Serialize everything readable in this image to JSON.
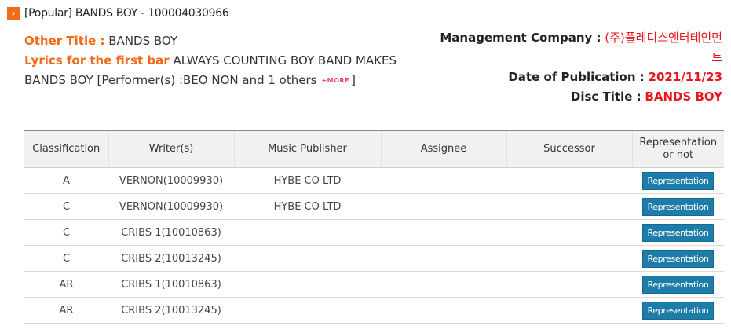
{
  "header": {
    "arrow_glyph": "›",
    "title": "[Popular] BANDS BOY - 100004030966"
  },
  "info": {
    "other_title_label": "Other Title :",
    "other_title_value": "BANDS BOY",
    "lyrics_label": "Lyrics for the first bar",
    "lyrics_value_1": "ALWAYS COUNTING BOY BAND MAKES",
    "lyrics_value_2": "BANDS BOY [Performer(s) :BEO NON and 1 others",
    "more_label": "+MORE",
    "close_bracket": "]"
  },
  "meta": {
    "management_label": "Management Company :",
    "management_value_1": "(주)플레디스엔터테인먼",
    "management_value_2": "트",
    "publication_label": "Date of Publication :",
    "publication_value": "2021/11/23",
    "disc_label": "Disc Title :",
    "disc_value": "BANDS BOY"
  },
  "table": {
    "headers": {
      "classification": "Classification",
      "writer": "Writer(s)",
      "publisher": "Music Publisher",
      "assignee": "Assignee",
      "successor": "Successor",
      "representation_1": "Representation",
      "representation_2": "or not"
    },
    "button_label": "Representation",
    "rows": [
      {
        "classification": "A",
        "writer": "VERNON(10009930)",
        "publisher": "HYBE CO LTD",
        "assignee": "",
        "successor": ""
      },
      {
        "classification": "C",
        "writer": "VERNON(10009930)",
        "publisher": "HYBE CO LTD",
        "assignee": "",
        "successor": ""
      },
      {
        "classification": "C",
        "writer": "CRIBS 1(10010863)",
        "publisher": "",
        "assignee": "",
        "successor": ""
      },
      {
        "classification": "C",
        "writer": "CRIBS 2(10013245)",
        "publisher": "",
        "assignee": "",
        "successor": ""
      },
      {
        "classification": "AR",
        "writer": "CRIBS 1(10010863)",
        "publisher": "",
        "assignee": "",
        "successor": ""
      },
      {
        "classification": "AR",
        "writer": "CRIBS 2(10013245)",
        "publisher": "",
        "assignee": "",
        "successor": ""
      }
    ]
  },
  "colors": {
    "accent_orange": "#f06a1a",
    "value_red": "#e8161e",
    "button_blue": "#1e7ca8"
  }
}
